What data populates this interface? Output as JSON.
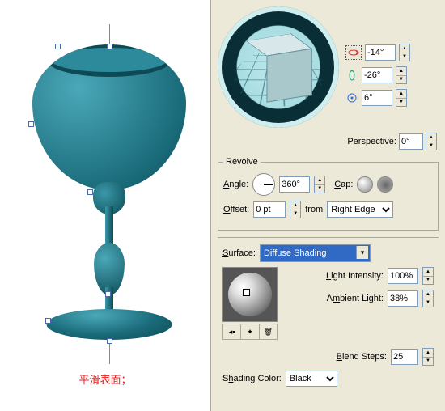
{
  "caption": "平滑表面；",
  "rotation": {
    "x": "-14°",
    "y": "-26°",
    "z": "6°"
  },
  "perspective": {
    "label": "Perspective:",
    "value": "0°"
  },
  "revolve": {
    "legend": "Revolve",
    "angle_label": "Angle:",
    "angle_value": "360°",
    "cap_label": "Cap:",
    "offset_label": "Offset:",
    "offset_value": "0 pt",
    "from_label": "from",
    "from_value": "Right Edge"
  },
  "surface": {
    "label": "Surface:",
    "value": "Diffuse Shading",
    "light_intensity_label": "Light Intensity:",
    "light_intensity_value": "100%",
    "ambient_light_label": "Ambient Light:",
    "ambient_light_value": "38%",
    "blend_steps_label": "Blend Steps:",
    "blend_steps_value": "25",
    "shading_color_label": "Shading Color:",
    "shading_color_value": "Black"
  }
}
